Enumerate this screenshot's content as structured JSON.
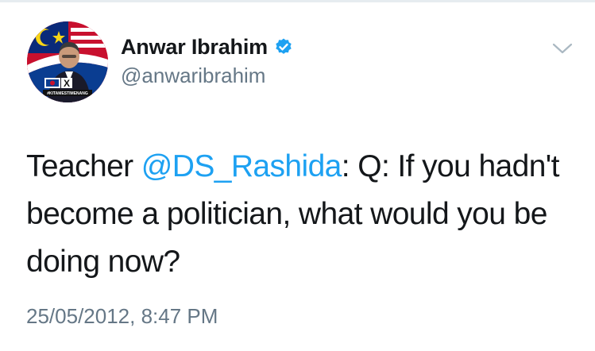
{
  "tweet": {
    "author": {
      "display_name": "Anwar Ibrahim",
      "handle": "@anwaribrahim",
      "verified": true,
      "avatar_caption": "#KITAMESTIMENANG"
    },
    "text_parts": {
      "before": "Teacher ",
      "mention": "@DS_Rashida",
      "after": ": Q: If you hadn't become a politician, what would you be doing now?"
    },
    "timestamp": "25/05/2012, 8:47 PM"
  },
  "icons": {
    "verified": "verified-badge-icon",
    "menu": "chevron-down-icon"
  },
  "colors": {
    "link": "#1da1f2",
    "secondary_text": "#657786",
    "primary_text": "#14171a",
    "verified_badge": "#1da1f2",
    "avatar_red": "#c8102e",
    "avatar_blue": "#0a3d91"
  }
}
